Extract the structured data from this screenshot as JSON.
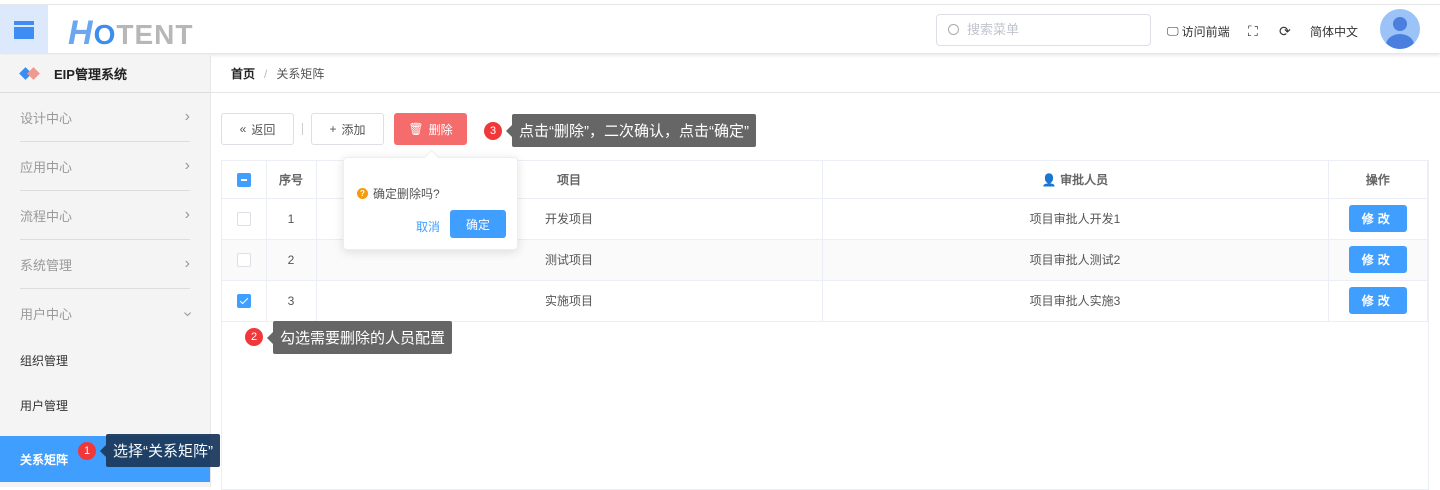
{
  "header": {
    "logo_h": "H",
    "logo_o": "O",
    "logo_rest": "TENT",
    "search_placeholder": "搜索菜单",
    "visit_frontend": "访问前端",
    "language": "简体中文"
  },
  "sidebar": {
    "system_title": "EIP管理系统",
    "groups": [
      {
        "label": "设计中心"
      },
      {
        "label": "应用中心"
      },
      {
        "label": "流程中心"
      },
      {
        "label": "系统管理"
      },
      {
        "label": "用户中心"
      }
    ],
    "sub_items": [
      {
        "label": "组织管理"
      },
      {
        "label": "用户管理"
      },
      {
        "label": "关系矩阵"
      }
    ]
  },
  "breadcrumb": {
    "home": "首页",
    "separator": "/",
    "current": "关系矩阵"
  },
  "toolbar": {
    "back": "返回",
    "add": "添加",
    "delete": "删除"
  },
  "table": {
    "headers": {
      "index": "序号",
      "project": "项目",
      "approver": "审批人员",
      "action": "操作"
    },
    "rows": [
      {
        "index": "1",
        "project": "开发项目",
        "approver": "项目审批人开发1",
        "action": "修改",
        "checked": false
      },
      {
        "index": "2",
        "project": "测试项目",
        "approver": "项目审批人测试2",
        "action": "修改",
        "checked": false
      },
      {
        "index": "3",
        "project": "实施项目",
        "approver": "项目审批人实施3",
        "action": "修改",
        "checked": true
      }
    ]
  },
  "popconfirm": {
    "message": "确定删除吗?",
    "cancel": "取消",
    "confirm": "确定"
  },
  "annotations": [
    {
      "num": "1",
      "text": "选择“关系矩阵”"
    },
    {
      "num": "2",
      "text": "勾选需要删除的人员配置"
    },
    {
      "num": "3",
      "text": "点击“删除”，二次确认，点击“确定”"
    }
  ]
}
